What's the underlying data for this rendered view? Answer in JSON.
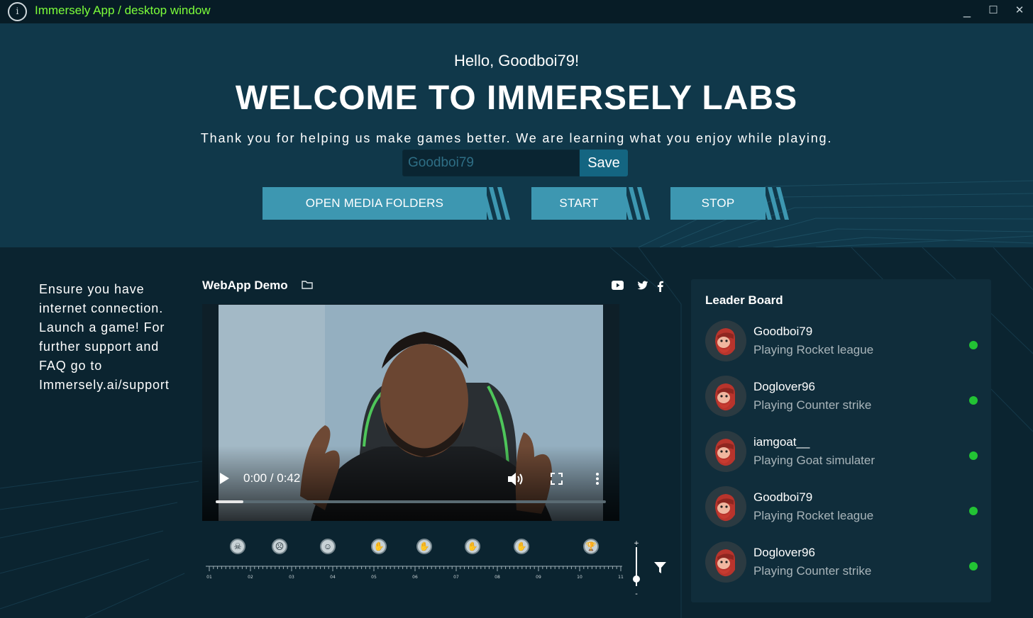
{
  "window": {
    "title": "Immersely App / desktop window",
    "app_icon_glyph": "i",
    "controls": {
      "minimize": "_",
      "maximize": "☐",
      "close": "✕"
    }
  },
  "hero": {
    "greeting": "Hello, Goodboi79!",
    "headline": "WELCOME TO IMMERSELY LABS",
    "tagline": "Thank you for helping us make games better. We are learning what you enjoy while playing.",
    "name_input": {
      "value": "Goodboi79",
      "placeholder": ""
    },
    "save_label": "Save",
    "buttons": {
      "open_media": "OPEN MEDIA FOLDERS",
      "start": "START",
      "stop": "STOP"
    }
  },
  "help_text": "Ensure you have internet connection. Launch a game! For further support and FAQ go to Immersely.ai/support",
  "video": {
    "title": "WebApp Demo",
    "time": "0:00 / 0:42",
    "progress_fraction": 0.07,
    "icons": [
      "folder-icon",
      "youtube-icon",
      "twitter-icon",
      "facebook-icon",
      "play-icon",
      "volume-icon",
      "fullscreen-icon",
      "more-vertical-icon"
    ]
  },
  "timeline": {
    "events": [
      {
        "name": "skull-icon",
        "glyph": "☠"
      },
      {
        "name": "sad-face-icon",
        "glyph": "☹"
      },
      {
        "name": "happy-face-icon",
        "glyph": "☺"
      },
      {
        "name": "hand-icon",
        "glyph": "✋"
      },
      {
        "name": "hand-icon",
        "glyph": "✋"
      },
      {
        "name": "hand-icon",
        "glyph": "✋"
      },
      {
        "name": "hand-icon",
        "glyph": "✋"
      },
      {
        "name": "trophy-icon",
        "glyph": "🏆"
      }
    ],
    "tick_labels": [
      "01",
      "02",
      "03",
      "04",
      "05",
      "06",
      "07",
      "08",
      "09",
      "10",
      "11"
    ],
    "zoom_plus": "+",
    "zoom_minus": "-"
  },
  "leaderboard": {
    "title": "Leader Board",
    "players": [
      {
        "name": "Goodboi79",
        "status": "Playing Rocket league",
        "online": true
      },
      {
        "name": "Doglover96",
        "status": "Playing Counter strike",
        "online": true
      },
      {
        "name": "iamgoat__",
        "status": "Playing Goat simulater",
        "online": true
      },
      {
        "name": "Goodboi79",
        "status": "Playing Rocket league",
        "online": true
      },
      {
        "name": "Doglover96",
        "status": "Playing Counter strike",
        "online": true
      }
    ]
  },
  "colors": {
    "title_green": "#7cff3a",
    "button_blue": "#3d97b1",
    "save_blue": "#146581",
    "online_green": "#22c334",
    "hero_bg": "#10384a",
    "body_bg": "#0b2430"
  }
}
